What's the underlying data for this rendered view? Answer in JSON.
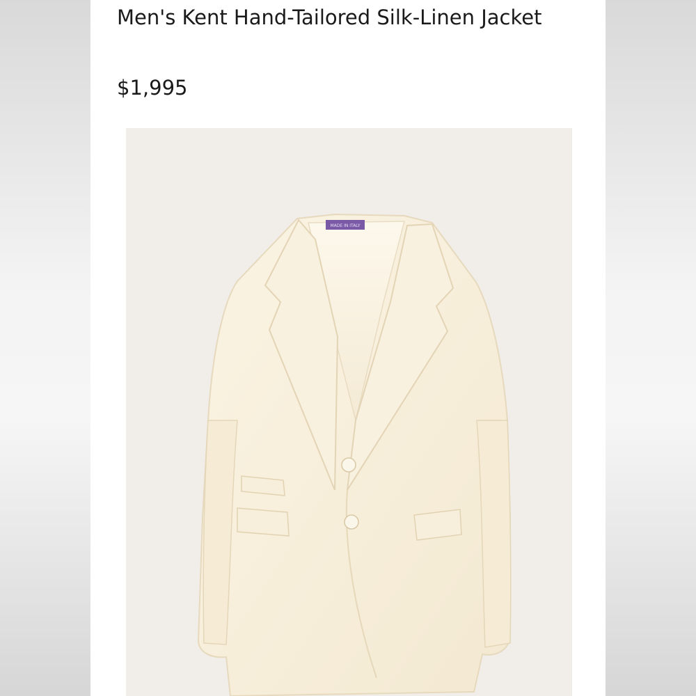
{
  "product": {
    "title": "Men's Kent Hand-Tailored Silk-Linen Jacket",
    "price": "$1,995",
    "image_alt": "cream jacket product photo",
    "label_tag_text": "MADE IN ITALY"
  },
  "colors": {
    "background": "#ffffff",
    "photo_background": "#f1ede8",
    "jacket": "#f8f0dc",
    "label": "#7a5aa6"
  }
}
